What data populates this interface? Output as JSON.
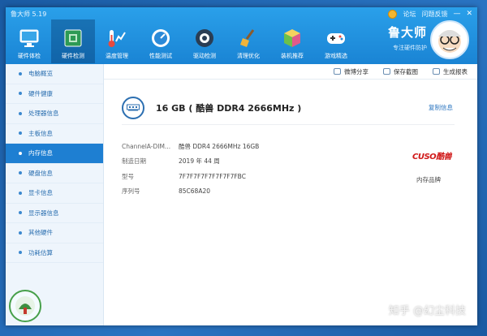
{
  "app": {
    "title": "鲁大师 5.19"
  },
  "top_links": {
    "forum": "论坛",
    "feedback": "问题反馈",
    "minimize": "—",
    "close": "✕"
  },
  "nav": [
    {
      "label": "硬件体检",
      "icon": "monitor-icon"
    },
    {
      "label": "硬件检测",
      "icon": "board-icon"
    },
    {
      "label": "温度管理",
      "icon": "thermometer-icon"
    },
    {
      "label": "性能测试",
      "icon": "speedometer-icon"
    },
    {
      "label": "驱动检测",
      "icon": "gear-icon"
    },
    {
      "label": "清理优化",
      "icon": "broom-icon"
    },
    {
      "label": "装机推荐",
      "icon": "cube-icon"
    },
    {
      "label": "游戏精选",
      "icon": "gamepad-icon"
    }
  ],
  "brand": {
    "name": "鲁大师",
    "slogan": "专注硬件防护"
  },
  "sidebar": {
    "items": [
      {
        "label": "电脑概览"
      },
      {
        "label": "硬件健康"
      },
      {
        "label": "处理器信息"
      },
      {
        "label": "主板信息"
      },
      {
        "label": "内存信息"
      },
      {
        "label": "硬盘信息"
      },
      {
        "label": "显卡信息"
      },
      {
        "label": "显示器信息"
      },
      {
        "label": "其他硬件"
      },
      {
        "label": "功耗估算"
      }
    ]
  },
  "toolbar": {
    "share": "微博分享",
    "screenshot": "保存截图",
    "report": "生成报表"
  },
  "memory": {
    "title": "16 GB ( 酷兽 DDR4 2666MHz )",
    "copy_label": "复制信息",
    "rows": [
      {
        "key": "ChannelA-DIM...",
        "value": "酷兽 DDR4 2666MHz 16GB"
      },
      {
        "key": "制造日期",
        "value": "2019 年 44 周"
      },
      {
        "key": "型号",
        "value": "7F7F7F7F7F7F7F7FBC"
      },
      {
        "key": "序列号",
        "value": "85C68A20"
      }
    ],
    "brand_logo": "CUSO酷兽",
    "brand_label": "内存品牌"
  },
  "watermark": "知乎 @幻尘科技",
  "colors": {
    "accent": "#1e7fd2",
    "topbar": "#1a84d4",
    "brand_red": "#d01818"
  }
}
